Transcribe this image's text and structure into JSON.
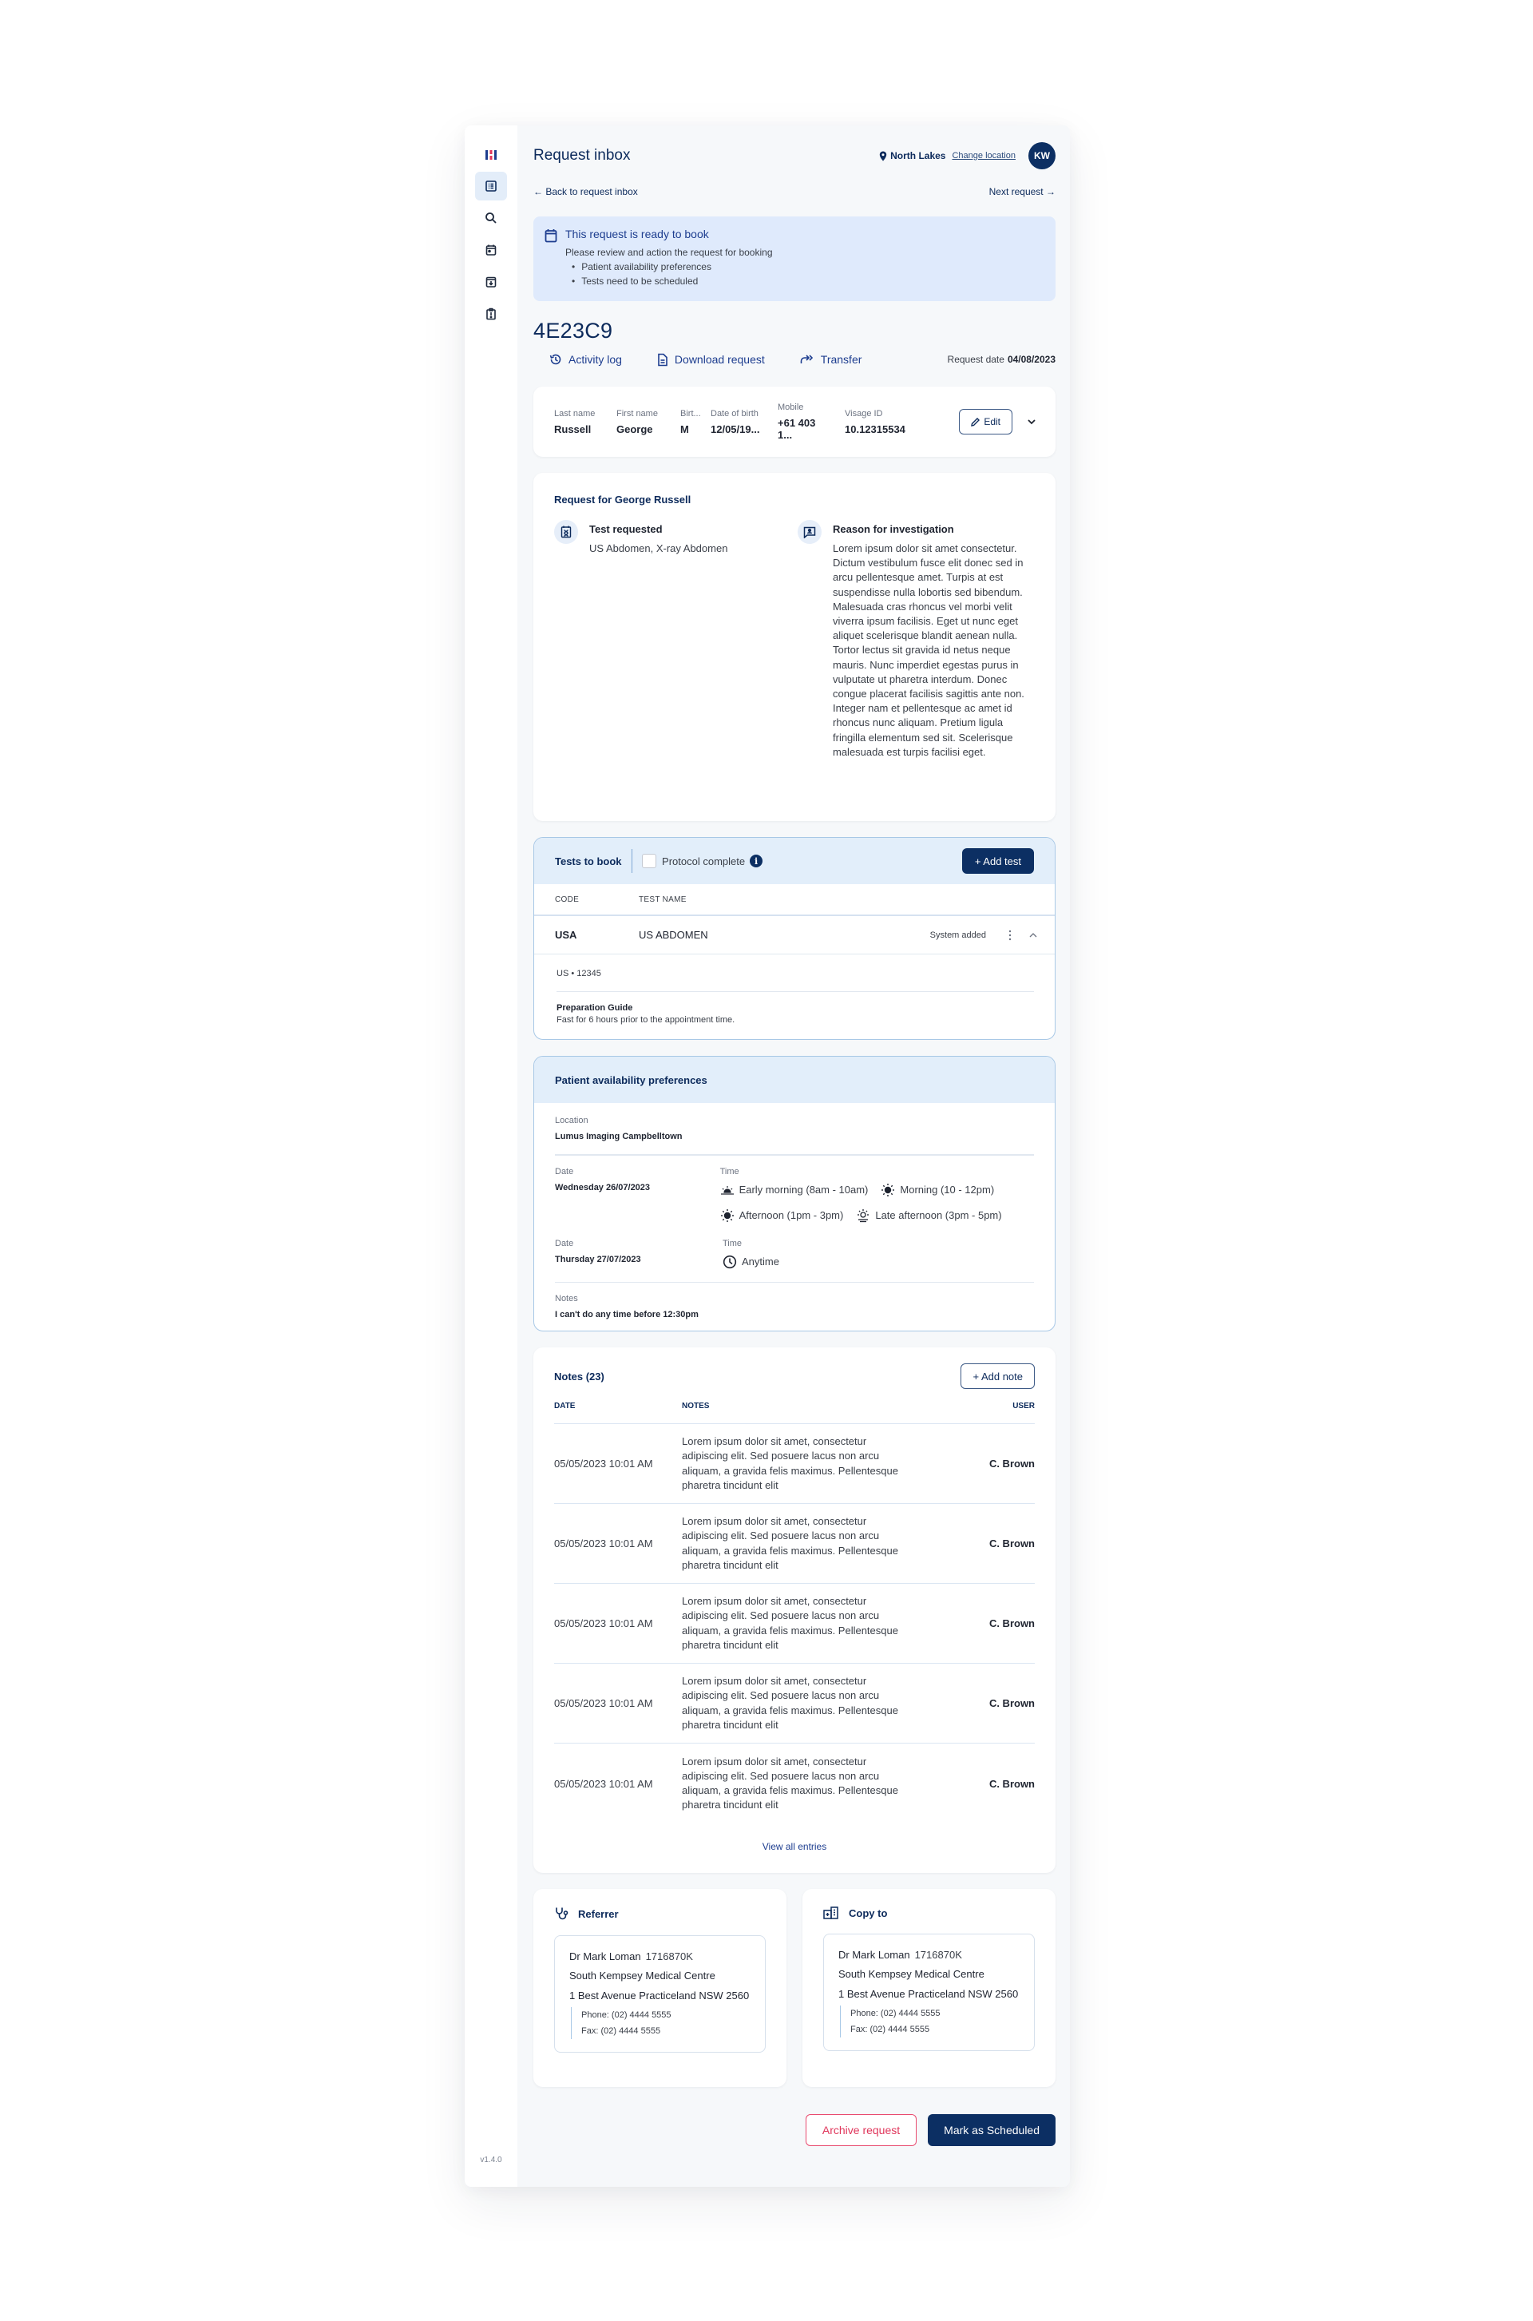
{
  "app": {
    "version": "v1.4.0",
    "brand_colors": {
      "primary": "#0c2f63",
      "accent_red": "#e0365b",
      "banner_bg": "#dfeafc"
    }
  },
  "sidebar": {
    "items": [
      {
        "name": "logo",
        "icon": "brand-logo-icon"
      },
      {
        "name": "request-inbox",
        "icon": "list-icon",
        "active": true
      },
      {
        "name": "search",
        "icon": "search-icon"
      },
      {
        "name": "calendar",
        "icon": "calendar-icon"
      },
      {
        "name": "archive",
        "icon": "archive-icon"
      },
      {
        "name": "alerts",
        "icon": "clipboard-alert-icon"
      }
    ]
  },
  "header": {
    "title": "Request inbox",
    "location": "North Lakes",
    "change_location": "Change location",
    "avatar_initials": "KW"
  },
  "nav": {
    "back": "Back to request inbox",
    "next": "Next request"
  },
  "banner": {
    "title": "This request is ready to book",
    "text": "Please review and action the request for booking",
    "bullets": [
      "Patient availability preferences",
      "Tests need to be scheduled"
    ]
  },
  "request": {
    "id": "4E23C9",
    "actions": [
      "Activity log",
      "Download request",
      "Transfer"
    ],
    "date_label": "Request date",
    "date": "04/08/2023"
  },
  "patient": {
    "fields": [
      {
        "label": "Last name",
        "value": "Russell"
      },
      {
        "label": "First name",
        "value": "George"
      },
      {
        "label": "Birt...",
        "value": "M"
      },
      {
        "label": "Date of birth",
        "value": "12/05/19..."
      },
      {
        "label": "Mobile",
        "value": "+61 403 1..."
      },
      {
        "label": "Visage ID",
        "value": "10.12315534"
      }
    ],
    "edit_label": "Edit"
  },
  "request_details": {
    "title": "Request for George Russell",
    "test_requested_label": "Test requested",
    "test_requested": "US Abdomen, X-ray Abdomen",
    "reason_label": "Reason for investigation",
    "reason": "Lorem ipsum dolor sit amet consectetur. Dictum vestibulum fusce elit donec sed in arcu pellentesque amet. Turpis at est suspendisse nulla lobortis sed bibendum. Malesuada cras rhoncus vel morbi velit viverra ipsum facilisis. Eget ut nunc eget aliquet scelerisque blandit aenean nulla. Tortor lectus sit gravida id netus neque mauris. Nunc imperdiet egestas purus in vulputate ut pharetra interdum. Donec congue placerat facilisis sagittis ante non. Integer nam et pellentesque ac amet id rhoncus nunc aliquam. Pretium ligula fringilla elementum sed sit. Scelerisque malesuada est turpis facilisi eget."
  },
  "tests": {
    "title": "Tests to book",
    "protocol_label": "Protocol complete",
    "protocol_checked": false,
    "add_label": "+ Add test",
    "columns": [
      "CODE",
      "TEST NAME"
    ],
    "rows": [
      {
        "code": "USA",
        "name": "US ABDOMEN",
        "status": "System added",
        "detail_code": "US • 12345",
        "prep_title": "Preparation Guide",
        "prep_text": "Fast for 6 hours prior to the appointment time."
      }
    ]
  },
  "availability": {
    "title": "Patient availability preferences",
    "location_label": "Location",
    "location": "Lumus Imaging Campbelltown",
    "date_label": "Date",
    "time_label": "Time",
    "days": [
      {
        "date": "Wednesday 26/07/2023",
        "times": [
          {
            "label": "Early morning (8am - 10am)",
            "icon": "sunrise-icon"
          },
          {
            "label": "Morning (10 - 12pm)",
            "icon": "sun-icon"
          },
          {
            "label": "Afternoon (1pm - 3pm)",
            "icon": "sun-icon"
          },
          {
            "label": "Late afternoon (3pm - 5pm)",
            "icon": "sunset-icon"
          }
        ]
      },
      {
        "date": "Thursday 27/07/2023",
        "times": [
          {
            "label": "Anytime",
            "icon": "clock-icon"
          }
        ]
      }
    ],
    "notes_label": "Notes",
    "notes": "I can't do any time before 12:30pm"
  },
  "notes": {
    "title": "Notes (23)",
    "add_label": "+ Add note",
    "columns": [
      "DATE",
      "NOTES",
      "USER"
    ],
    "rows": [
      {
        "date": "05/05/2023 10:01 AM",
        "note": "Lorem ipsum dolor sit amet, consectetur adipiscing elit. Sed posuere lacus non arcu aliquam, a gravida felis maximus. Pellentesque pharetra tincidunt elit",
        "user": "C. Brown"
      },
      {
        "date": "05/05/2023 10:01 AM",
        "note": "Lorem ipsum dolor sit amet, consectetur adipiscing elit. Sed posuere lacus non arcu aliquam, a gravida felis maximus. Pellentesque pharetra tincidunt elit",
        "user": "C. Brown"
      },
      {
        "date": "05/05/2023 10:01 AM",
        "note": "Lorem ipsum dolor sit amet, consectetur adipiscing elit. Sed posuere lacus non arcu aliquam, a gravida felis maximus. Pellentesque pharetra tincidunt elit",
        "user": "C. Brown"
      },
      {
        "date": "05/05/2023 10:01 AM",
        "note": "Lorem ipsum dolor sit amet, consectetur adipiscing elit. Sed posuere lacus non arcu aliquam, a gravida felis maximus. Pellentesque pharetra tincidunt elit",
        "user": "C. Brown"
      },
      {
        "date": "05/05/2023 10:01 AM",
        "note": "Lorem ipsum dolor sit amet, consectetur adipiscing elit. Sed posuere lacus non arcu aliquam, a gravida felis maximus. Pellentesque pharetra tincidunt elit",
        "user": "C. Brown"
      }
    ],
    "view_all": "View all entries"
  },
  "contacts": [
    {
      "title": "Referrer",
      "icon": "stethoscope-icon",
      "name": "Dr Mark Loman",
      "provider_no": "1716870K",
      "practice": "South Kempsey Medical Centre",
      "address": "1 Best Avenue Practiceland NSW 2560",
      "phone": "Phone: (02) 4444 5555",
      "fax": "Fax: (02) 4444 5555"
    },
    {
      "title": "Copy to",
      "icon": "hospital-building-icon",
      "name": "Dr Mark Loman",
      "provider_no": "1716870K",
      "practice": "South Kempsey Medical Centre",
      "address": "1 Best Avenue Practiceland NSW 2560",
      "phone": "Phone: (02) 4444 5555",
      "fax": "Fax: (02) 4444 5555"
    }
  ],
  "footer": {
    "archive_label": "Archive request",
    "schedule_label": "Mark as Scheduled"
  }
}
